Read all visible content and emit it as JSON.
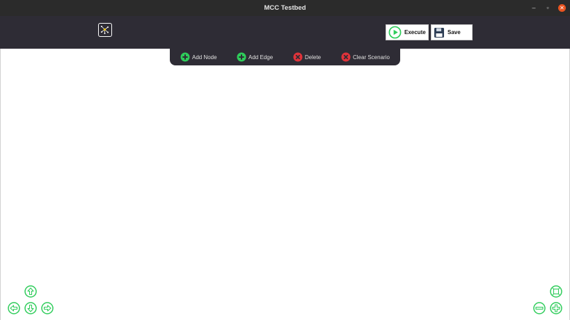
{
  "window": {
    "title": "MCC Testbed",
    "minimize_glyph": "–",
    "maximize_glyph": "▫",
    "close_glyph": "✕"
  },
  "toolbar": {
    "logo_icon": "graph-network-icon",
    "execute_label": "Execute",
    "save_label": "Save"
  },
  "menu": {
    "add_node_label": "Add Node",
    "add_edge_label": "Add Edge",
    "delete_label": "Delete",
    "clear_label": "Clear Scenario"
  },
  "colors": {
    "green": "#2ecc5a",
    "red": "#e0333a",
    "dark": "#2e2c35",
    "titlebar": "#2b2b2b",
    "close": "#e95420"
  }
}
